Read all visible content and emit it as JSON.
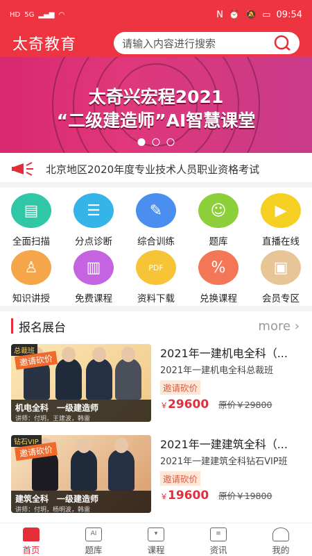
{
  "status_bar": {
    "left_icons": [
      "HD",
      "5G",
      "signal-icon",
      "wifi-icon"
    ],
    "time": "09:54"
  },
  "header": {
    "brand": "太奇教育",
    "search_placeholder": "请输入内容进行搜索"
  },
  "banner": {
    "line1": "太奇兴宏程2021",
    "line2": "“二级建造师”AI智慧课堂",
    "active_dot": 0,
    "dot_count": 3
  },
  "notice": {
    "text": "北京地区2020年度专业技术人员职业资格考试"
  },
  "grid": [
    {
      "label": "全面扫描",
      "icon": "book-scan-icon",
      "color": "#2fc7a6"
    },
    {
      "label": "分点诊断",
      "icon": "list-icon",
      "color": "#35b4e8"
    },
    {
      "label": "综合训练",
      "icon": "doc-edit-icon",
      "color": "#4a8ff0"
    },
    {
      "label": "题库",
      "icon": "ai-head-icon",
      "color": "#8ccf3a"
    },
    {
      "label": "直播在线",
      "icon": "tv-icon",
      "color": "#f5cf21"
    },
    {
      "label": "知识讲授",
      "icon": "teacher-icon",
      "color": "#f5a64a"
    },
    {
      "label": "免费课程",
      "icon": "books-icon",
      "color": "#c464e0"
    },
    {
      "label": "资料下载",
      "icon": "pdf-icon",
      "color": "#f7c438"
    },
    {
      "label": "兑换课程",
      "icon": "coupon-icon",
      "color": "#f37757"
    },
    {
      "label": "会员专区",
      "icon": "vip-box-icon",
      "color": "#e8c596"
    }
  ],
  "section": {
    "title": "报名展台",
    "more": "more"
  },
  "courses": [
    {
      "tag": "总裁班",
      "promo": "邀请砍价",
      "cap_title": "机电全科　一级建造师",
      "cap_teachers": "讲师：付玥，王建波，韩雷",
      "title": "2021年一建机电全科（...",
      "subtitle": "2021年一建机电全科总裁班",
      "badge": "邀请砍价",
      "currency": "￥",
      "price": "29600",
      "original": "原价￥29800"
    },
    {
      "tag": "钻石VIP",
      "promo": "邀请砍价",
      "cap_title": "建筑全科　一级建造师",
      "cap_teachers": "讲师：付玥，杨明波，韩雷",
      "title": "2021年一建建筑全科（...",
      "subtitle": "2021年一建建筑全科钻石VIP班",
      "badge": "邀请砍价",
      "currency": "￥",
      "price": "19600",
      "original": "原价￥19800"
    }
  ],
  "tabbar": [
    {
      "label": "首页",
      "icon": "home-icon",
      "active": true
    },
    {
      "label": "题库",
      "icon": "ai-icon",
      "active": false
    },
    {
      "label": "课程",
      "icon": "bookmark-book-icon",
      "active": false
    },
    {
      "label": "资讯",
      "icon": "news-icon",
      "active": false
    },
    {
      "label": "我的",
      "icon": "person-icon",
      "active": false
    }
  ],
  "colors": {
    "brand_red": "#ee3440",
    "price_red": "#e52d3a"
  }
}
